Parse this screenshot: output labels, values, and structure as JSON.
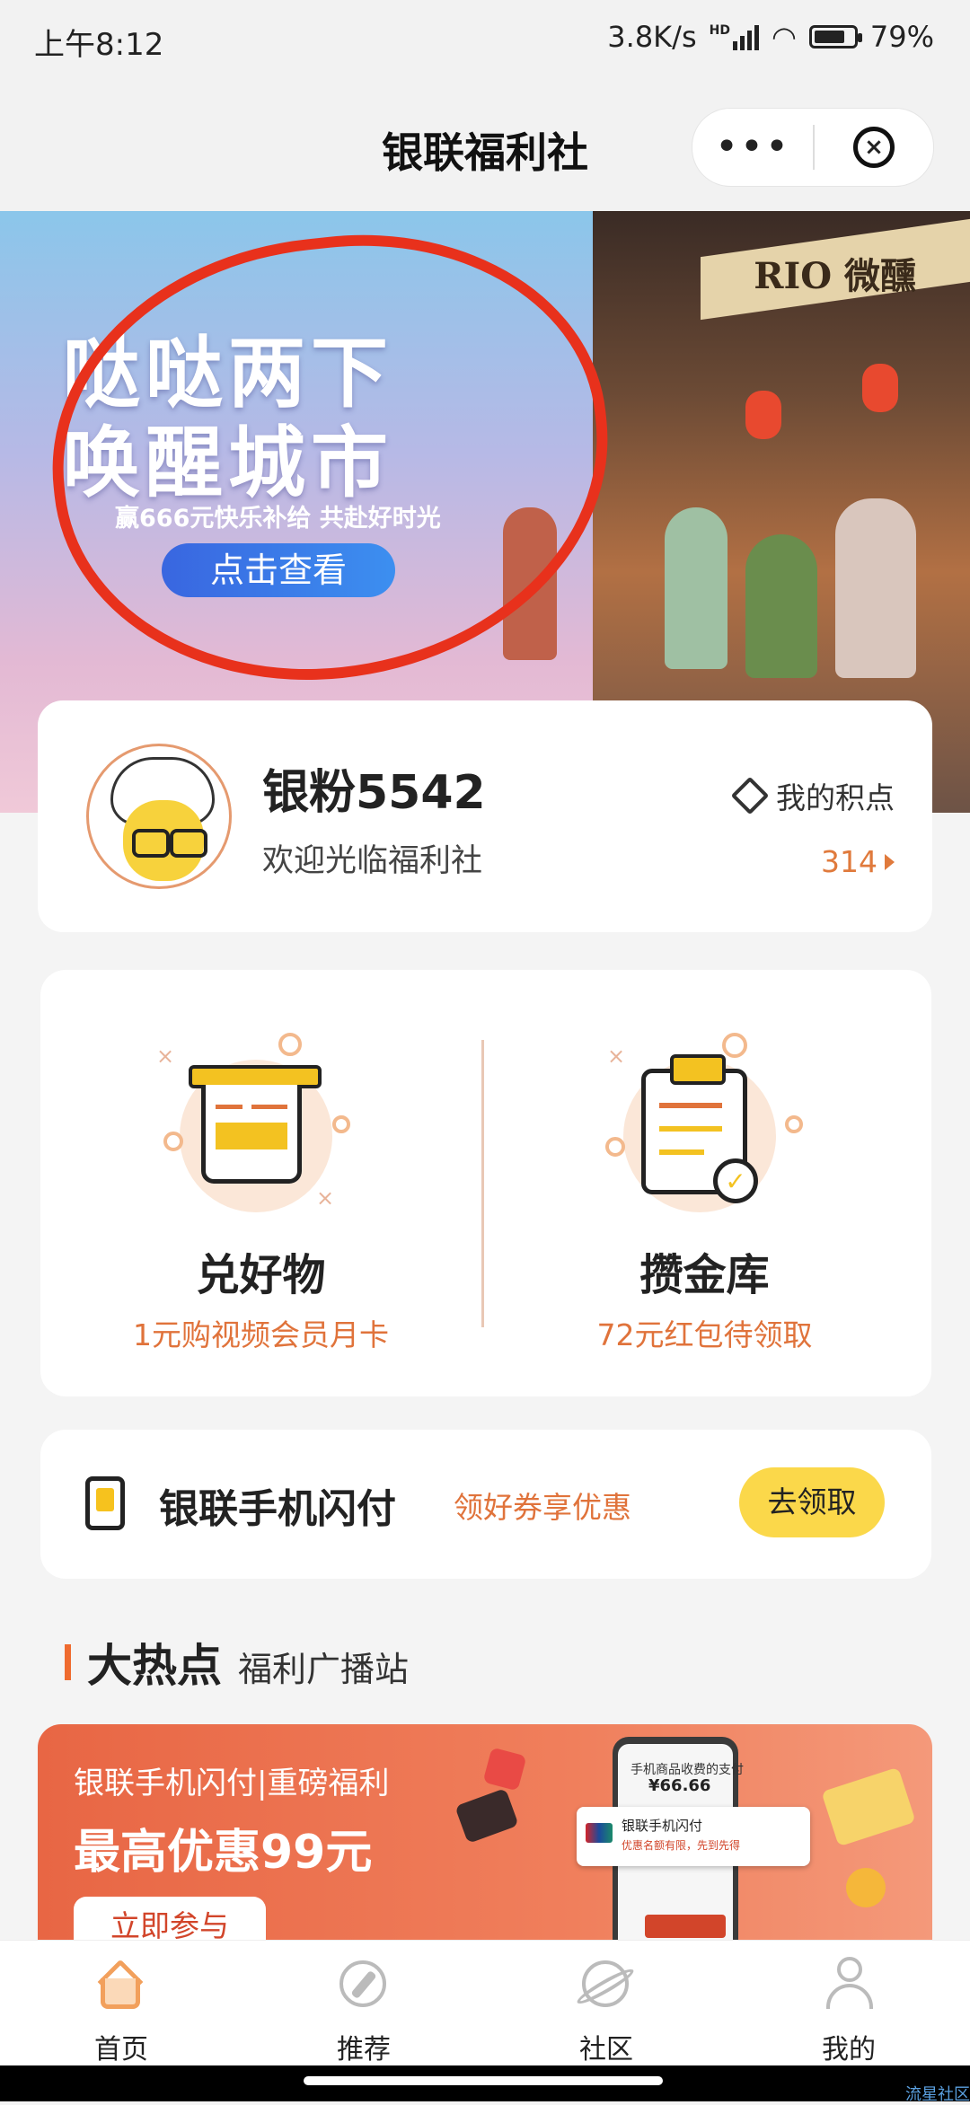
{
  "status_bar": {
    "time": "上午8:12",
    "network_speed": "3.8K/s",
    "network_type": "HD",
    "battery": "79%",
    "battery_level": 0.79
  },
  "navbar": {
    "title": "银联福利社",
    "more_icon": "more-icon",
    "close_icon": "close-circle-icon"
  },
  "banner": {
    "headline_1": "哒哒两下",
    "headline_2": "唤醒城市",
    "subtitle": "赢666元快乐补给 共赴好时光",
    "button": "点击查看",
    "sign_text": "RIO 微醺",
    "annotation_color": "#e8311c"
  },
  "user": {
    "name": "银粉5542",
    "greeting": "欢迎光临福利社",
    "points_label": "我的积点",
    "points_value": "314"
  },
  "features": [
    {
      "title": "兑好物",
      "subtitle": "1元购视频会员月卡",
      "icon": "ticket-icon"
    },
    {
      "title": "攒金库",
      "subtitle": "72元红包待领取",
      "icon": "clipboard-check-icon"
    }
  ],
  "flash_pay": {
    "title": "银联手机闪付",
    "desc": "领好券享优惠",
    "button": "去领取"
  },
  "section": {
    "title": "大热点",
    "subtitle": "福利广播站"
  },
  "promo": {
    "line1": "银联手机闪付|重磅福利",
    "line2": "最高优惠99元",
    "button": "立即参与",
    "mock_header": "手机商品收费的支付",
    "mock_price": "¥66.66",
    "mock_card_title": "银联手机闪付",
    "mock_card_desc": "优惠名额有限，先到先得"
  },
  "tabbar": [
    {
      "label": "首页",
      "icon": "home-icon",
      "active": true
    },
    {
      "label": "推荐",
      "icon": "compass-icon",
      "active": false
    },
    {
      "label": "社区",
      "icon": "planet-icon",
      "active": false
    },
    {
      "label": "我的",
      "icon": "profile-icon",
      "active": false
    }
  ],
  "watermark": "流星社区",
  "colors": {
    "accent_orange": "#e0733b",
    "button_yellow": "#fbd84a",
    "promo_red": "#e86644",
    "tab_active": "#f2a05c"
  }
}
